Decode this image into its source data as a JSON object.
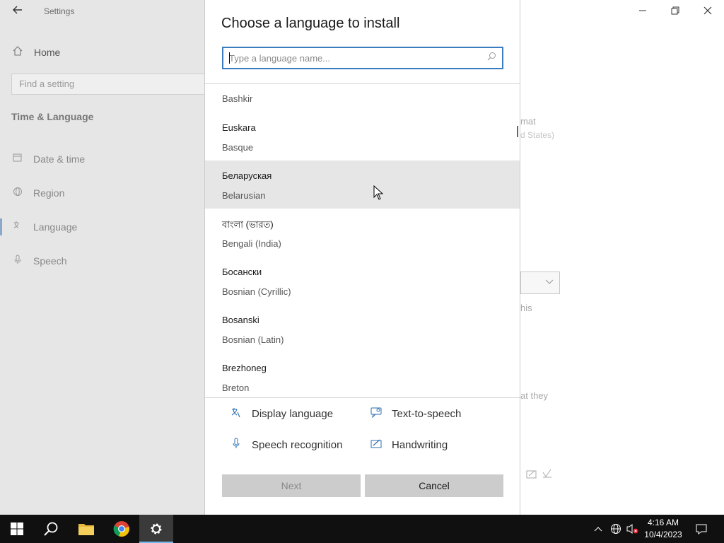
{
  "settings": {
    "window_title": "Settings",
    "home_label": "Home",
    "find_placeholder": "Find a setting",
    "section_title": "Time & Language",
    "nav_items": [
      {
        "label": "Date & time",
        "icon": "calendar-clock-icon"
      },
      {
        "label": "Region",
        "icon": "globe-icon"
      },
      {
        "label": "Language",
        "icon": "language-icon",
        "selected": true
      },
      {
        "label": "Speech",
        "icon": "microphone-icon"
      }
    ],
    "bg_fragments": {
      "format": "mat",
      "region": "d States)",
      "this": "his",
      "they": "at they"
    }
  },
  "dialog": {
    "title": "Choose a language to install",
    "search_placeholder": "Type a language name...",
    "languages": [
      {
        "native": "",
        "english": "Bashkir"
      },
      {
        "native": "Euskara",
        "english": "Basque"
      },
      {
        "native": "Беларуская",
        "english": "Belarusian"
      },
      {
        "native": "বাংলা (ভারত)",
        "english": "Bengali (India)"
      },
      {
        "native": "Босански",
        "english": "Bosnian (Cyrillic)"
      },
      {
        "native": "Bosanski",
        "english": "Bosnian (Latin)"
      },
      {
        "native": "Brezhoneg",
        "english": "Breton"
      }
    ],
    "features": {
      "display_language": "Display language",
      "text_to_speech": "Text-to-speech",
      "speech_recognition": "Speech recognition",
      "handwriting": "Handwriting"
    },
    "next_label": "Next",
    "cancel_label": "Cancel"
  },
  "taskbar": {
    "time": "4:16 AM",
    "date": "10/4/2023"
  },
  "colors": {
    "accent": "#3b7bbf",
    "selected_row": "#e6e6e6",
    "taskbar": "#101010"
  }
}
